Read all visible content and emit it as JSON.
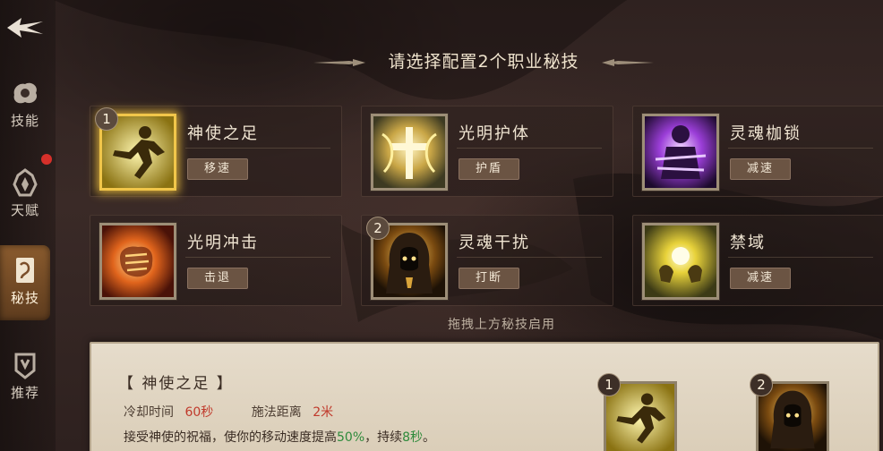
{
  "header": {
    "title": "请选择配置2个职业秘技"
  },
  "nav": {
    "items": [
      {
        "label": "技能",
        "icon": "skill-icon"
      },
      {
        "label": "天赋",
        "icon": "talent-icon",
        "badge": true
      },
      {
        "label": "秘技",
        "icon": "secret-skill-icon",
        "active": true
      },
      {
        "label": "推荐",
        "icon": "recommend-icon"
      }
    ]
  },
  "cards": [
    {
      "name": "神使之足",
      "tag": "移速",
      "badge": "1",
      "selected": true,
      "icon": "running-figure-icon"
    },
    {
      "name": "光明护体",
      "tag": "护盾",
      "icon": "holy-cross-icon"
    },
    {
      "name": "灵魂枷锁",
      "tag": "减速",
      "icon": "soul-chain-icon"
    },
    {
      "name": "光明冲击",
      "tag": "击退",
      "icon": "fiery-fist-icon"
    },
    {
      "name": "灵魂干扰",
      "tag": "打断",
      "badge": "2",
      "icon": "hooded-figure-icon"
    },
    {
      "name": "禁域",
      "tag": "减速",
      "icon": "glowing-hands-icon"
    }
  ],
  "hint": "拖拽上方秘技启用",
  "detail": {
    "title": "【 神使之足 】",
    "cooldown_label": "冷却时间",
    "cooldown_value": "60秒",
    "range_label": "施法距离",
    "range_value": "2米",
    "desc_prefix": "接受神使的祝福，使你的移动速度提高",
    "desc_pct": "50%",
    "desc_mid": "，持续",
    "desc_dur": "8秒",
    "desc_suffix": "。",
    "slots": [
      {
        "badge": "1",
        "icon": "running-figure-icon"
      },
      {
        "badge": "2",
        "icon": "hooded-figure-icon"
      }
    ]
  },
  "colors": {
    "accent_gold": "#f1c64a",
    "tag_bg": "#6b5443",
    "red_value": "#c0392b",
    "green_value": "#2e8a3b"
  }
}
